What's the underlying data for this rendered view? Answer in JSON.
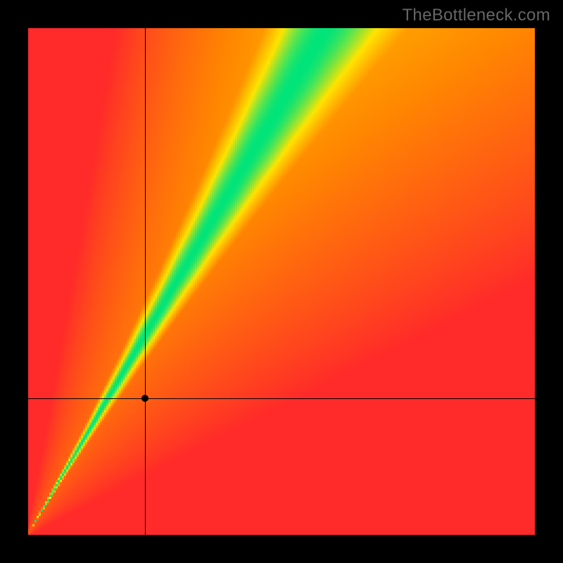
{
  "watermark": "TheBottleneck.com",
  "chart_data": {
    "type": "heatmap",
    "title": "",
    "xlabel": "",
    "ylabel": "",
    "xlim": [
      0,
      100
    ],
    "ylim": [
      0,
      100
    ],
    "grid": false,
    "legend": false,
    "crosshair": {
      "x": 23,
      "y": 27
    },
    "optimal_curve_description": "diagonal 'ideal' band rising from bottom-left to top-right with slope ~1.7 (y ≈ 1.7x), band narrows toward origin",
    "color_scale": {
      "low": "#ff2a2a",
      "mid_low": "#ff8a00",
      "mid": "#ffe400",
      "high": "#00e47a"
    },
    "series": [
      {
        "name": "distance-to-optimal (normalized)",
        "note": "Each pixel's color encodes proximity to the optimal y = 1.7·x line; green = on-line, yellow = near, orange/red = bottleneck region."
      }
    ]
  }
}
